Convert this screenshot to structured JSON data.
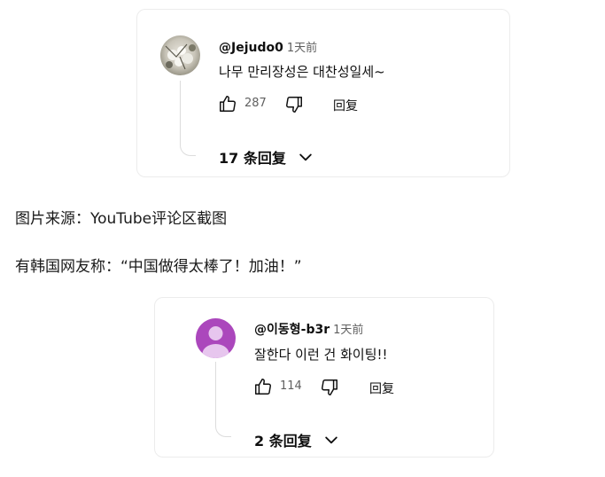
{
  "comments": [
    {
      "handle": "@Jejudo0",
      "time": "1天前",
      "text": "나무 만리장성은 대찬성일세~",
      "likes": "287",
      "reply_label": "回复",
      "replies_label": "17 条回复",
      "avatar": "photo-avatar"
    },
    {
      "handle": "@이동형-b3r",
      "time": "1天前",
      "text": "잘한다 이런 건 화이팅!!",
      "likes": "114",
      "reply_label": "回复",
      "replies_label": "2 条回复",
      "avatar": "default-avatar",
      "avatar_color": "#ab47bc"
    }
  ],
  "article": {
    "caption": "图片来源：YouTube评论区截图",
    "paragraph": "有韩国网友称：“中国做得太棒了！加油！”"
  },
  "icons": {
    "like": "thumbs-up-icon",
    "dislike": "thumbs-down-icon",
    "expand": "chevron-down-icon"
  }
}
